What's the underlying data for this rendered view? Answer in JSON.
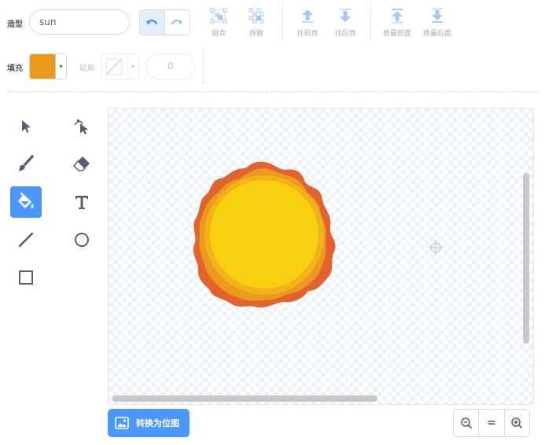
{
  "costume": {
    "label": "造型",
    "value": "sun"
  },
  "toolbar": {
    "group": "组合",
    "ungroup": "拆散",
    "forward": "往前放",
    "backward": "往后放",
    "front": "放最前面",
    "back": "放最后面"
  },
  "fill": {
    "label": "填充",
    "color": "#eb9a1e"
  },
  "outline": {
    "label": "轮廓",
    "width": "0"
  },
  "tools": [
    "select-tool",
    "reshape-tool",
    "brush-tool",
    "eraser-tool",
    "fill-tool",
    "text-tool",
    "line-tool",
    "circle-tool",
    "rectangle-tool"
  ],
  "selected_tool": "fill-tool",
  "convert_button": {
    "label": "转换为位图"
  },
  "zoom": {
    "reset_label": "="
  },
  "colors": {
    "accent": "#4c97ff",
    "sun_outer": "#e2632e",
    "sun_mid": "#eb9a1e",
    "sun_inner": "#f9d00f",
    "icon": "#575e75"
  }
}
